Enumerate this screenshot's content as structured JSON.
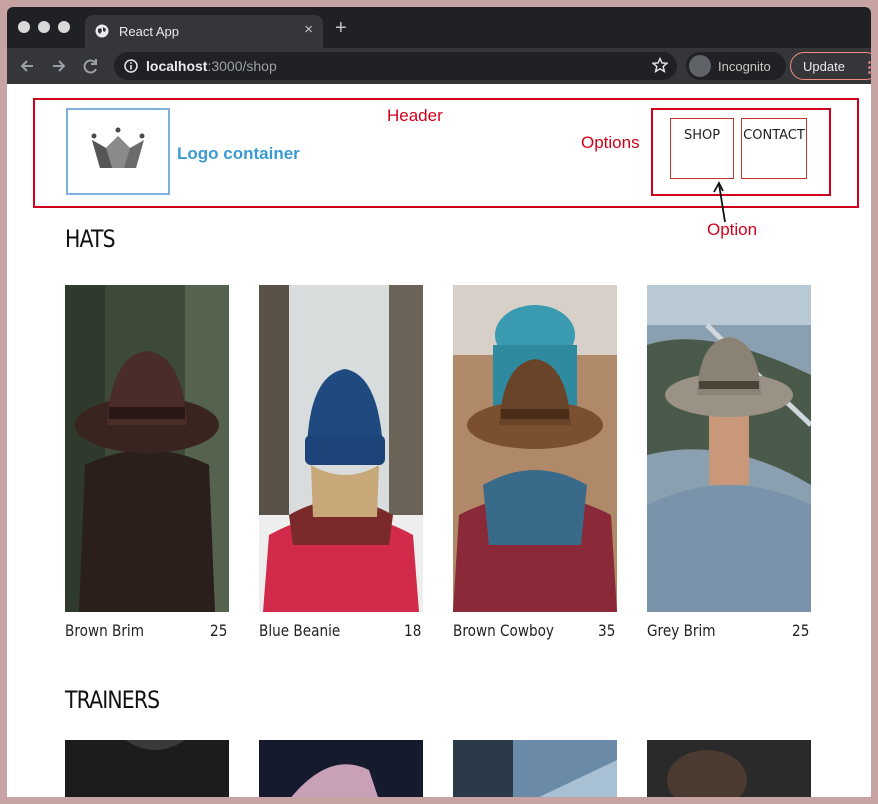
{
  "browser": {
    "tab_title": "React App",
    "tab_close": "×",
    "new_tab": "+",
    "url_host": "localhost",
    "url_path": ":3000/shop",
    "incognito_label": "Incognito",
    "update_label": "Update",
    "menu_dots": "⋮"
  },
  "annotations": {
    "header": "Header",
    "options": "Options",
    "option": "Option",
    "logo_container": "Logo container"
  },
  "nav": {
    "shop": "SHOP",
    "contact": "CONTACT"
  },
  "sections": {
    "hats": {
      "title": "HATS",
      "items": [
        {
          "name": "Brown Brim",
          "price": "25"
        },
        {
          "name": "Blue Beanie",
          "price": "18"
        },
        {
          "name": "Brown Cowboy",
          "price": "35"
        },
        {
          "name": "Grey Brim",
          "price": "25"
        }
      ]
    },
    "trainers": {
      "title": "TRAINERS"
    }
  },
  "colors": {
    "annotation_red": "#d0021b",
    "logo_blue": "#3b9ad1",
    "browser_dark": "#202124"
  }
}
